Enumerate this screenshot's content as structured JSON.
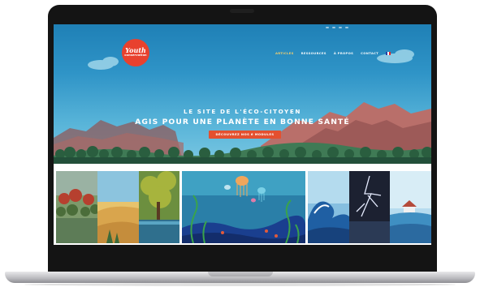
{
  "site": {
    "logo": {
      "line1": "Youth",
      "line2": "conservation"
    },
    "nav": [
      {
        "label": "ARTICLES",
        "active": true
      },
      {
        "label": "RESSOURCES",
        "active": false
      },
      {
        "label": "À PROPOS",
        "active": false
      },
      {
        "label": "CONTACT",
        "active": false
      }
    ],
    "language_flag": "french-flag-icon",
    "hero": {
      "subtitle": "LE SITE DE L'ÉCO-CITOYEN",
      "title": "AGIS POUR UNE PLANÈTE EN BONNE SANTÉ",
      "cta": "DÉCOUVREZ NOS 6 MODULES"
    },
    "gallery": [
      {
        "name": "landscapes-tile",
        "panels": [
          "forest",
          "desert",
          "tree"
        ]
      },
      {
        "name": "ocean-tile",
        "panels": [
          "jellyfish-ocean"
        ]
      },
      {
        "name": "climate-tile",
        "panels": [
          "wave",
          "lightning-storm",
          "flood"
        ]
      }
    ]
  },
  "colors": {
    "accent": "#e4502f",
    "logo": "#e8412e",
    "sky": "#2f94c7",
    "nav_active": "#ffd36a"
  }
}
